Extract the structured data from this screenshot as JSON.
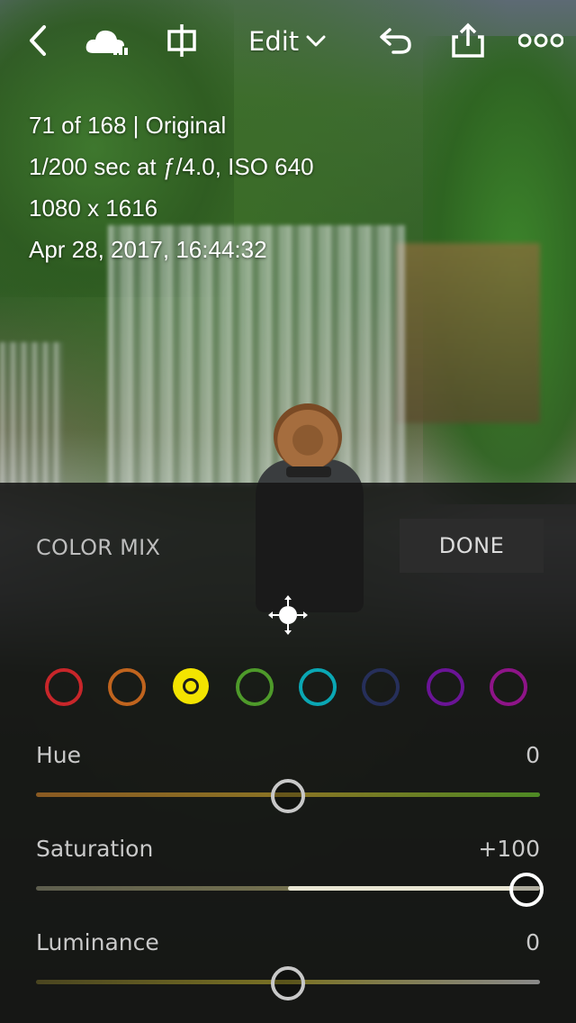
{
  "toolbar": {
    "back_icon": "chevron-left-icon",
    "cloud_icon": "cloud-sync-icon",
    "compare_icon": "before-after-icon",
    "edit_label": "Edit",
    "edit_dropdown_icon": "chevron-down-icon",
    "undo_icon": "undo-icon",
    "share_icon": "share-icon",
    "more_icon": "more-icon"
  },
  "info": {
    "position": "71 of 168 | Original",
    "exposure": "1/200 sec at ƒ/4.0, ISO 640",
    "dimensions": "1080 x 1616",
    "datetime": "Apr 28, 2017, 16:44:32"
  },
  "panel": {
    "title": "COLOR MIX",
    "done_label": "DONE",
    "target_icon": "target-adjustment-icon",
    "colors": [
      {
        "name": "red",
        "color": "#c8262a",
        "selected": false
      },
      {
        "name": "orange",
        "color": "#c0641e",
        "selected": false
      },
      {
        "name": "yellow",
        "color": "#f3e400",
        "selected": true
      },
      {
        "name": "green",
        "color": "#4e9a2a",
        "selected": false
      },
      {
        "name": "aqua",
        "color": "#0aa7b4",
        "selected": false
      },
      {
        "name": "blue",
        "color": "#262f5a",
        "selected": false
      },
      {
        "name": "purple",
        "color": "#6a1496",
        "selected": false
      },
      {
        "name": "magenta",
        "color": "#8e1488",
        "selected": false
      }
    ],
    "sliders": [
      {
        "label": "Hue",
        "value": "0",
        "fraction": 0.5
      },
      {
        "label": "Saturation",
        "value": "+100",
        "fraction": 1.0
      },
      {
        "label": "Luminance",
        "value": "0",
        "fraction": 0.5
      }
    ]
  }
}
